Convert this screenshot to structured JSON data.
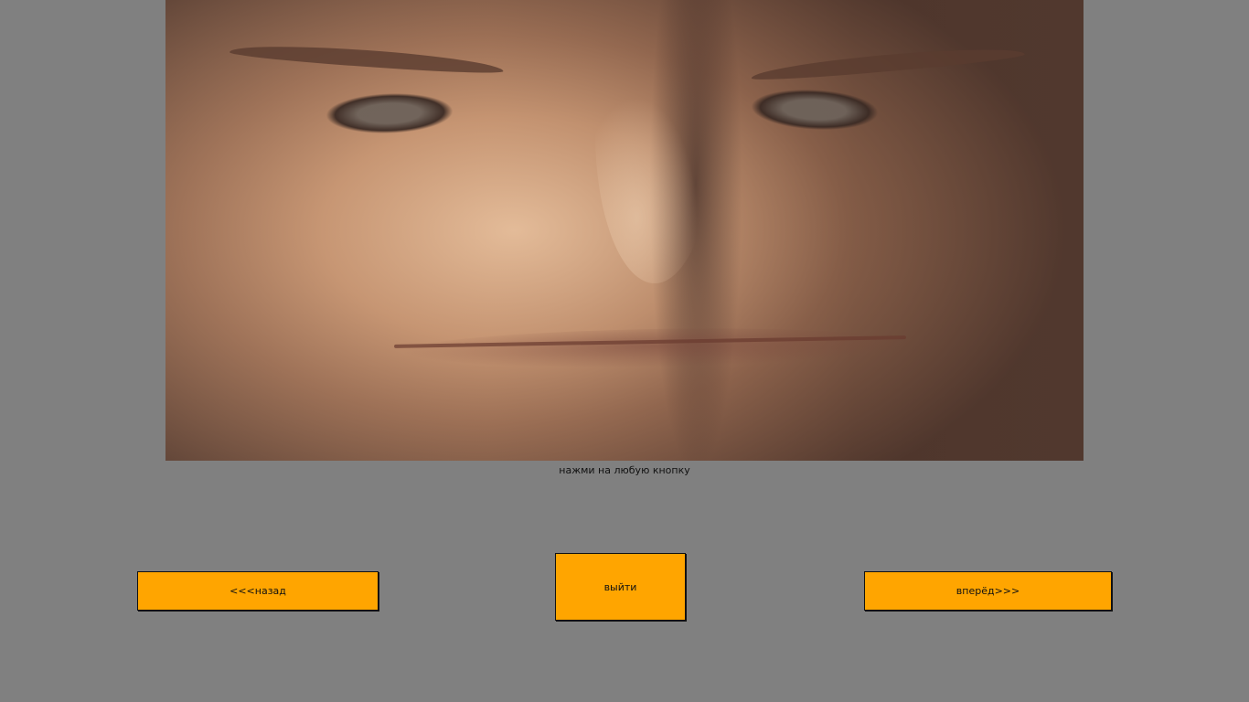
{
  "photo": {
    "subject": "face-photo"
  },
  "hint": {
    "text": "нажми на любую кнопку"
  },
  "buttons": {
    "back": "<<<назад",
    "exit": "выйти",
    "next": "вперёд>>>"
  },
  "colors": {
    "background": "#808080",
    "button": "#ffa500",
    "text": "#111111"
  }
}
